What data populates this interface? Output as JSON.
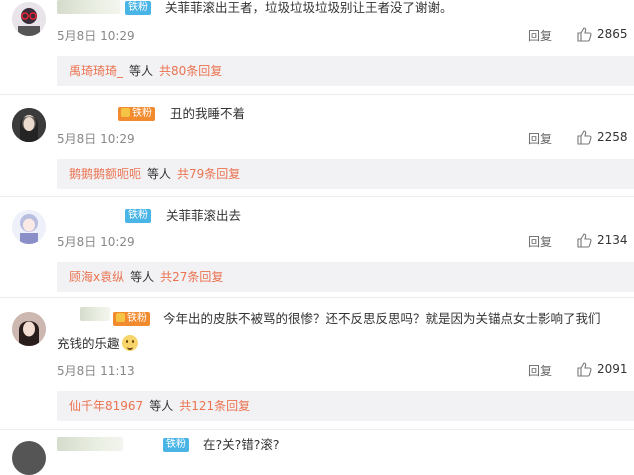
{
  "comments": [
    {
      "badge": "铁粉",
      "badge_type": "fan",
      "text": "关菲菲滚出王者，垃圾垃圾垃圾别让王者没了谢谢。",
      "time": "5月8日 10:29",
      "reply": "回复",
      "likes": "2865",
      "replies": {
        "author": "禹琦琦琦_",
        "etc": "等人",
        "more": "共80条回复"
      }
    },
    {
      "badge": "铁粉",
      "badge_type": "vip",
      "text": "丑的我睡不着",
      "time": "5月8日 10:29",
      "reply": "回复",
      "likes": "2258",
      "replies": {
        "author": "鹅鹅鹅额呃呃",
        "etc": "等人",
        "more": "共79条回复"
      }
    },
    {
      "badge": "铁粉",
      "badge_type": "fan",
      "text": "关菲菲滚出去",
      "time": "5月8日 10:29",
      "reply": "回复",
      "likes": "2134",
      "replies": {
        "author": "顾海x袁纵",
        "etc": "等人",
        "more": "共27条回复"
      }
    },
    {
      "badge": "铁粉",
      "badge_type": "vip",
      "text": "今年出的皮肤不被骂的很惨？还不反思反思吗？就是因为关锚点女士影响了我们",
      "text2": "充钱的乐趣",
      "time": "5月8日 11:13",
      "reply": "回复",
      "likes": "2091",
      "replies": {
        "author": "仙千年81967",
        "etc": "等人",
        "more": "共121条回复"
      }
    },
    {
      "badge": "铁粉",
      "badge_type": "fan",
      "text": "在?关?错?滚?"
    }
  ],
  "colors": {
    "link": "#eb7350",
    "fan_badge": "#49b4e6",
    "vip_badge": "#f28a2e",
    "reply_bg": "#f2f2f5"
  }
}
